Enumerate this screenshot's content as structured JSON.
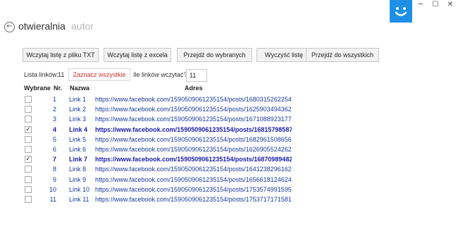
{
  "app": {
    "title": "otwieralnia",
    "subtitle": "autor"
  },
  "window": {
    "minimize": "─",
    "maximize": "☐",
    "close": "✕"
  },
  "toolbar": {
    "btn_txt": "Wczytaj listę z pliku TXT",
    "btn_excel": "Wczytaj listę z excela",
    "btn_go_selected": "Przejdź do wybranych",
    "btn_clear": "Wyczyść listę",
    "btn_go_all": "Przejdź do wszystkich"
  },
  "summary": {
    "list_label": "Lista linków:",
    "list_count": "11",
    "select_all": "Zaznacz wszystkie",
    "how_many_label": "Ile linków wczytać?:",
    "how_many_value": "11"
  },
  "table": {
    "headers": {
      "selected": "Wybrane",
      "nr": "Nr.",
      "name": "Nazwa",
      "address": "Adres"
    },
    "rows": [
      {
        "checked": false,
        "nr": "1",
        "name": "Link 1",
        "address": "https://www.facebook.com/1590509061235154/posts/1680315262254533"
      },
      {
        "checked": false,
        "nr": "2",
        "name": "Link 2",
        "address": "https://www.facebook.com/1590509061235154/posts/1625903494362377"
      },
      {
        "checked": false,
        "nr": "3",
        "name": "Link 3",
        "address": "https://www.facebook.com/1590509061235154/posts/1671088923177167"
      },
      {
        "checked": true,
        "nr": "4",
        "name": "Link 4",
        "address": "https://www.facebook.com/1590509061235154/posts/1681579858794"
      },
      {
        "checked": false,
        "nr": "5",
        "name": "Link 5",
        "address": "https://www.facebook.com/1590509061235154/posts/1682961508656575"
      },
      {
        "checked": false,
        "nr": "6",
        "name": "Link 6",
        "address": "https://www.facebook.com/1590509061235154/posts/1626905524262174"
      },
      {
        "checked": true,
        "nr": "7",
        "name": "Link 7",
        "address": "https://www.facebook.com/1590509061235154/posts/1687098948248"
      },
      {
        "checked": false,
        "nr": "8",
        "name": "Link 8",
        "address": "https://www.facebook.com/1590509061235154/posts/1641238296162230"
      },
      {
        "checked": false,
        "nr": "9",
        "name": "Link 9",
        "address": "https://www.facebook.com/1590509061235154/posts/1656618124624247"
      },
      {
        "checked": false,
        "nr": "10",
        "name": "Link 10",
        "address": "https://www.facebook.com/1590509061235154/posts/1753574991595226"
      },
      {
        "checked": false,
        "nr": "11",
        "name": "Link 11",
        "address": "https://www.facebook.com/1590509061235154/posts/1753717171581008"
      }
    ]
  }
}
